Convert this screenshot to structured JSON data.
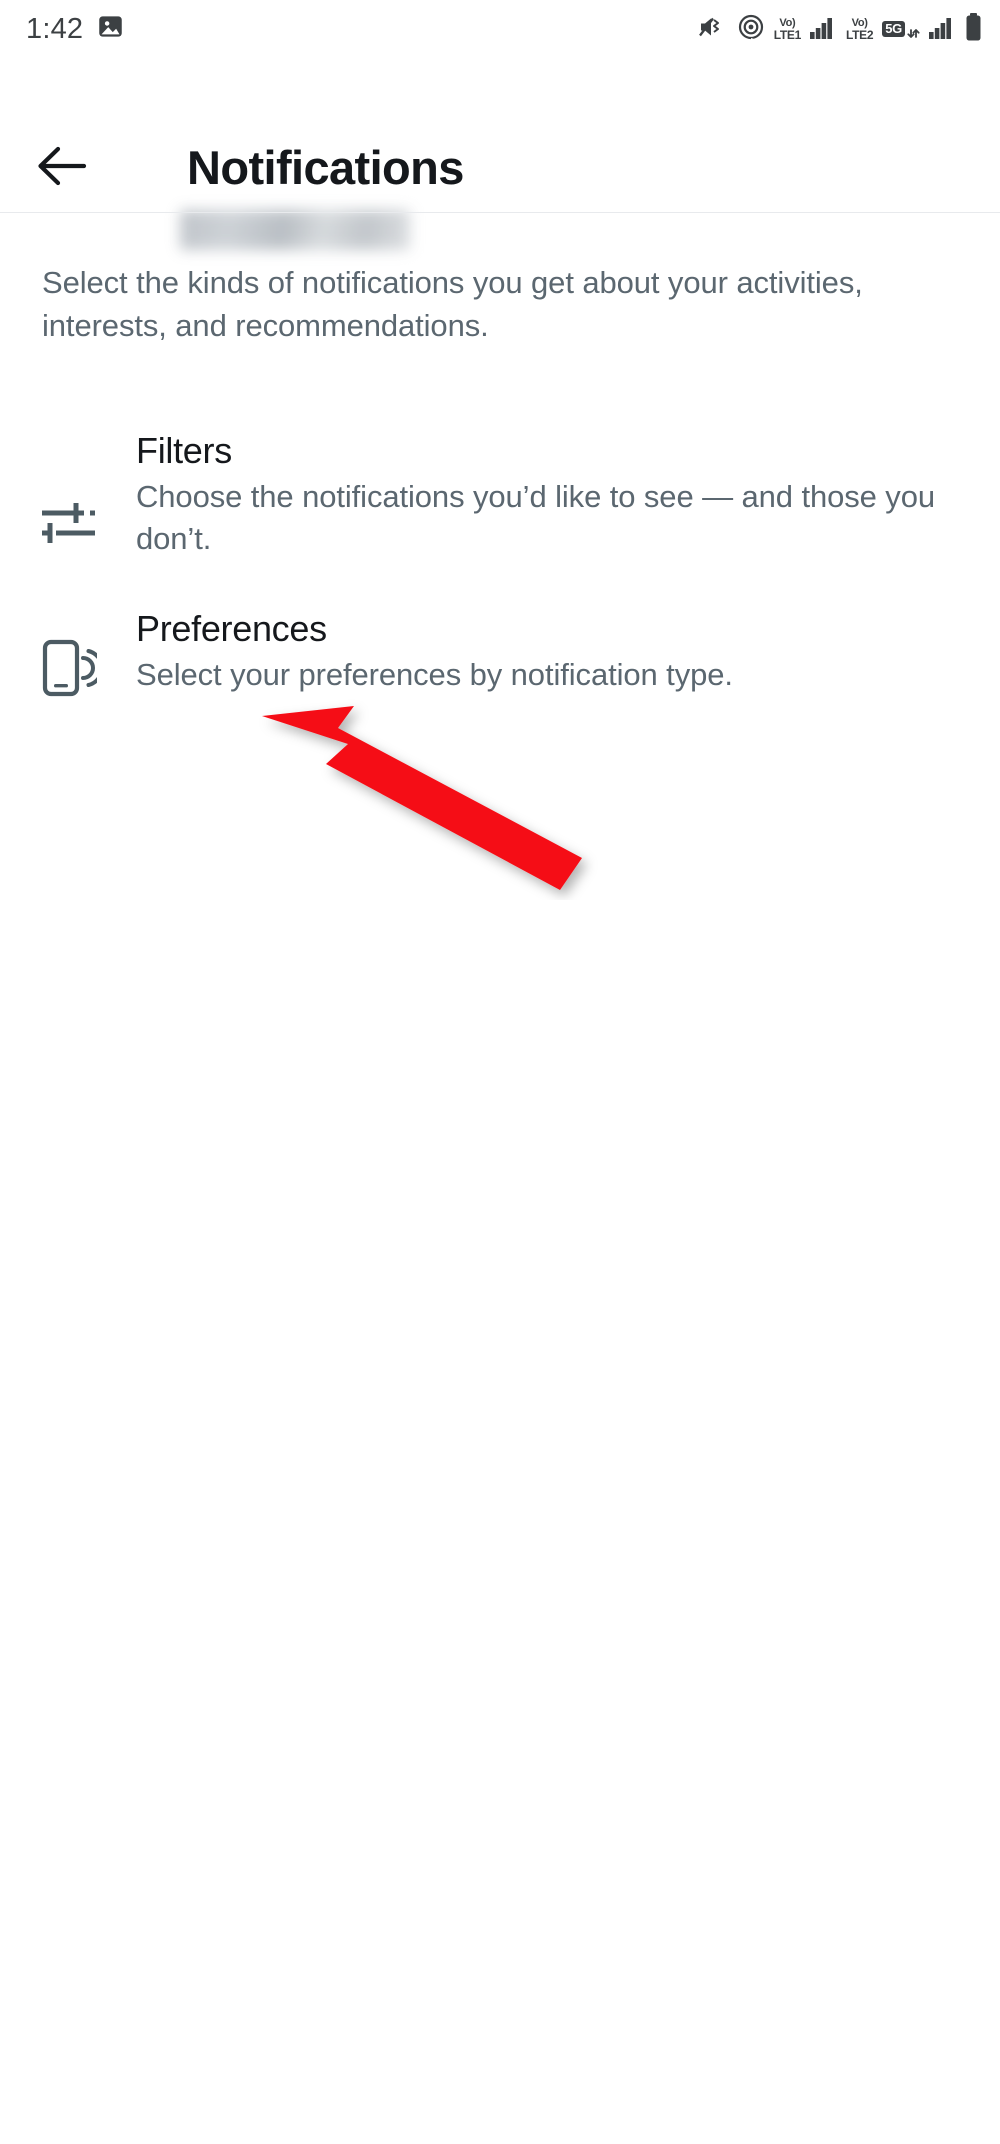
{
  "statusbar": {
    "time": "1:42",
    "photo_icon": "photo-icon",
    "mute_icon": "volume-mute-icon",
    "hotspot_icon": "hotspot-icon",
    "sim1": {
      "volte_top": "Vo)",
      "volte_bottom": "LTE1",
      "signal_icon": "signal-bars-icon"
    },
    "sim2": {
      "volte_top": "Vo)",
      "volte_bottom": "LTE2"
    },
    "fiveg": {
      "label": "5G",
      "data_arrows": "⇵",
      "signal_icon": "signal-bars-icon"
    },
    "battery_icon": "battery-full-icon"
  },
  "header": {
    "back_icon": "back-arrow-icon",
    "title": "Notifications",
    "subtitle_redacted": ""
  },
  "main": {
    "intro": "Select the kinds of notifications you get about your activities, interests, and recommendations.",
    "rows": [
      {
        "icon": "filters-sliders-icon",
        "title": "Filters",
        "subtitle": "Choose the notifications you’d like to see — and those you don’t."
      },
      {
        "icon": "phone-vibrate-icon",
        "title": "Preferences",
        "subtitle": "Select your preferences by notification type."
      }
    ]
  },
  "annotation": {
    "type": "arrow",
    "color": "#F50D16",
    "points_to": "Preferences"
  },
  "colors": {
    "text_primary": "#15181c",
    "text_secondary": "#5b6770",
    "status_icon": "#3c4043",
    "divider": "#e8eaed",
    "background": "#ffffff",
    "annotation_red": "#F50D16"
  }
}
